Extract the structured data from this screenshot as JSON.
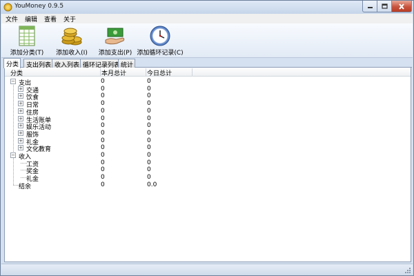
{
  "window": {
    "title": "YouMoney 0.9.5",
    "app_icon": "coin-icon"
  },
  "menu": [
    "文件",
    "编辑",
    "查看",
    "关于"
  ],
  "toolbar": [
    {
      "label": "添加分类(T)",
      "icon": "spreadsheet-icon"
    },
    {
      "label": "添加收入(I)",
      "icon": "coins-icon"
    },
    {
      "label": "添加支出(P)",
      "icon": "money-hand-icon"
    },
    {
      "label": "添加循环记录(C)",
      "icon": "clock-icon"
    }
  ],
  "tabs": [
    "分类",
    "支出列表",
    "收入列表",
    "循环记录列表",
    "统计"
  ],
  "active_tab": "分类",
  "columns": {
    "name": "分类",
    "month": "本月总计",
    "today": "今日总计"
  },
  "rows": [
    {
      "name": "支出",
      "level": 0,
      "expander": "−",
      "month": "0",
      "today": "0"
    },
    {
      "name": "交通",
      "level": 1,
      "expander": "+",
      "month": "0",
      "today": "0"
    },
    {
      "name": "饮食",
      "level": 1,
      "expander": "+",
      "month": "0",
      "today": "0"
    },
    {
      "name": "日常",
      "level": 1,
      "expander": "+",
      "month": "0",
      "today": "0"
    },
    {
      "name": "住房",
      "level": 1,
      "expander": "+",
      "month": "0",
      "today": "0"
    },
    {
      "name": "生活账单",
      "level": 1,
      "expander": "+",
      "month": "0",
      "today": "0"
    },
    {
      "name": "娱乐活动",
      "level": 1,
      "expander": "+",
      "month": "0",
      "today": "0"
    },
    {
      "name": "服饰",
      "level": 1,
      "expander": "+",
      "month": "0",
      "today": "0"
    },
    {
      "name": "礼金",
      "level": 1,
      "expander": "+",
      "month": "0",
      "today": "0"
    },
    {
      "name": "文化教育",
      "level": 1,
      "expander": "+",
      "month": "0",
      "today": "0"
    },
    {
      "name": "收入",
      "level": 0,
      "expander": "−",
      "month": "0",
      "today": "0"
    },
    {
      "name": "工资",
      "level": 1,
      "expander": "",
      "month": "0",
      "today": "0"
    },
    {
      "name": "奖金",
      "level": 1,
      "expander": "",
      "month": "0",
      "today": "0"
    },
    {
      "name": "礼金",
      "level": 1,
      "expander": "",
      "month": "0",
      "today": "0"
    },
    {
      "name": "结余",
      "level": 0,
      "expander": "",
      "month": "0",
      "today": "0.0"
    }
  ],
  "window_buttons": [
    "minimize-icon",
    "maximize-icon",
    "close-icon"
  ]
}
